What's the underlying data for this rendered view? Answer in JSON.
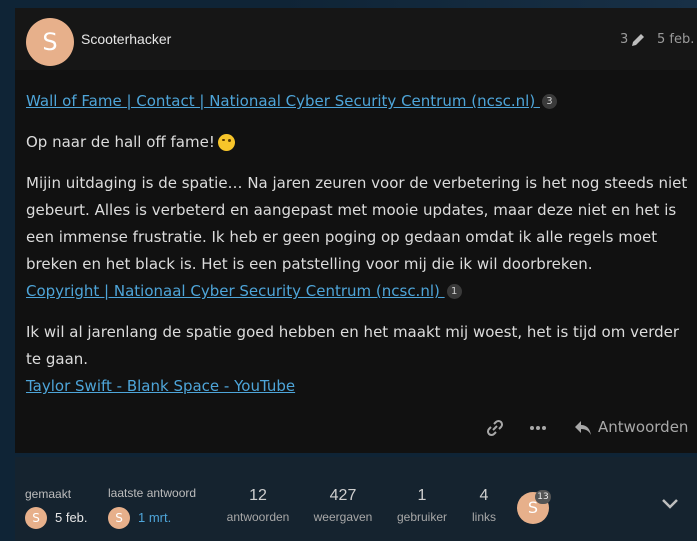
{
  "post": {
    "avatar_letter": "S",
    "username": "Scooterhacker",
    "edit_count": "3",
    "date": "5 feb.",
    "link1": "Wall of Fame | Contact | Nationaal Cyber Security Centrum (ncsc.nl) ",
    "link1_count": "3",
    "line1": "Op naar de hall off fame!",
    "emoji_icon": "winking-face-emoji",
    "paragraph": "Mijin uitdaging is de spatie… Na jaren zeuren voor de verbetering is het nog steeds niet gebeurt. Alles is verbeterd en aangepast met mooie updates, maar deze niet en het is een immense frustratie. Ik heb er geen poging op gedaan omdat ik alle regels moet breken en het black is. Het is een patstelling voor mij die ik wil doorbreken.",
    "link2": "Copyright | Nationaal Cyber Security Centrum (ncsc.nl) ",
    "link2_count": "1",
    "paragraph2": "Ik wil al jarenlang de spatie goed hebben en het maakt mij woest, het is tijd om verder te gaan.",
    "link3": "Taylor Swift - Blank Space - YouTube"
  },
  "actions": {
    "link_icon": "link-icon",
    "more_icon": "ellipsis-icon",
    "reply_icon": "reply-arrow-icon",
    "reply_label": "Antwoorden"
  },
  "footer": {
    "created_label": "gemaakt",
    "created_avatar": "S",
    "created_date": "5 feb.",
    "last_reply_label": "laatste antwoord",
    "last_avatar": "S",
    "last_date": "1 mrt.",
    "stats": [
      {
        "num": "12",
        "label": "antwoorden"
      },
      {
        "num": "427",
        "label": "weergaven"
      },
      {
        "num": "1",
        "label": "gebruiker"
      },
      {
        "num": "4",
        "label": "links"
      }
    ],
    "participant_letter": "S",
    "participant_count": "13",
    "expand_icon": "chevron-down-icon"
  },
  "colors": {
    "link": "#4ea5d9",
    "avatar": "#e7b08b",
    "post_bg": "#111111",
    "footer_bg": "#15232f"
  }
}
